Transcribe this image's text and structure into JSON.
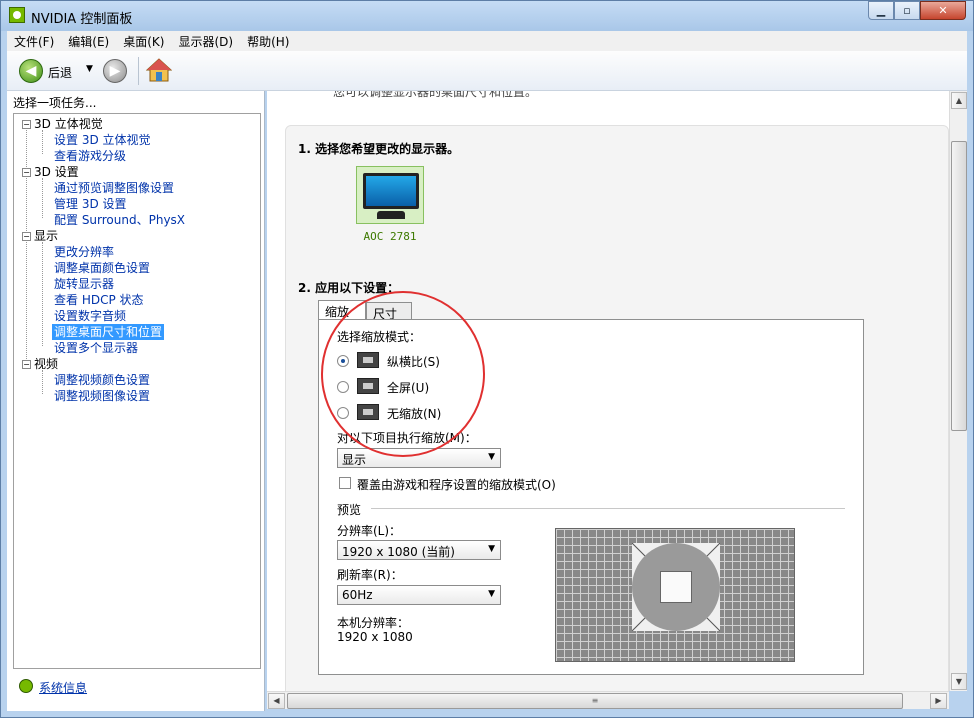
{
  "window": {
    "title": "NVIDIA 控制面板"
  },
  "menubar": [
    {
      "label": "文件(F)"
    },
    {
      "label": "编辑(E)"
    },
    {
      "label": "桌面(K)"
    },
    {
      "label": "显示器(D)"
    },
    {
      "label": "帮助(H)"
    }
  ],
  "toolbar": {
    "back_label": "后退"
  },
  "leftpane": {
    "header": "选择一项任务...",
    "categories": [
      {
        "label": "3D 立体视觉",
        "items": [
          "设置 3D 立体视觉",
          "查看游戏分级"
        ]
      },
      {
        "label": "3D 设置",
        "items": [
          "通过预览调整图像设置",
          "管理 3D 设置",
          "配置 Surround、PhysX"
        ]
      },
      {
        "label": "显示",
        "items": [
          "更改分辨率",
          "调整桌面颜色设置",
          "旋转显示器",
          "查看 HDCP 状态",
          "设置数字音频",
          "调整桌面尺寸和位置",
          "设置多个显示器"
        ]
      },
      {
        "label": "视频",
        "items": [
          "调整视频颜色设置",
          "调整视频图像设置"
        ]
      }
    ],
    "selected_item": "调整桌面尺寸和位置",
    "system_info": "系统信息"
  },
  "main": {
    "cutoff_text": "您可以调整显示器的桌面尺寸和位置。",
    "step1": "1. 选择您希望更改的显示器。",
    "monitor_label": "AOC 2781",
    "step2": "2. 应用以下设置：",
    "tabs": [
      {
        "label": "缩放"
      },
      {
        "label": "尺寸"
      }
    ],
    "scaling_mode_label": "选择缩放模式：",
    "modes": [
      {
        "label": "纵横比(S)",
        "selected": true
      },
      {
        "label": "全屏(U)",
        "selected": false
      },
      {
        "label": "无缩放(N)",
        "selected": false
      }
    ],
    "perform_on_label": "对以下项目执行缩放(M)：",
    "perform_on_value": "显示",
    "override_label": "覆盖由游戏和程序设置的缩放模式(O)",
    "preview_label": "预览",
    "resolution_label": "分辨率(L)：",
    "resolution_value": "1920 x 1080 (当前)",
    "refresh_label": "刷新率(R)：",
    "refresh_value": "60Hz",
    "native_label": "本机分辨率：",
    "native_value": "1920 x 1080"
  }
}
